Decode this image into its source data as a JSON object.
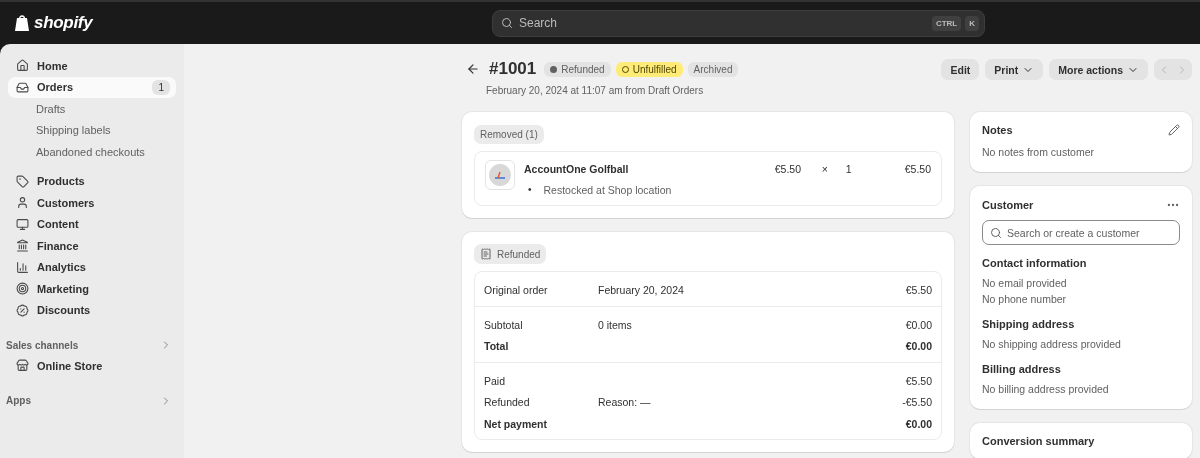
{
  "topbar": {
    "logo": "shopify",
    "search": {
      "placeholder": "Search",
      "keys": [
        "CTRL",
        "K"
      ]
    }
  },
  "sidebar": {
    "items": [
      {
        "label": "Home",
        "kind": "main",
        "selected": false
      },
      {
        "label": "Orders",
        "kind": "main",
        "selected": true,
        "count": "1"
      },
      {
        "label": "Drafts",
        "kind": "sub",
        "selected": false
      },
      {
        "label": "Shipping labels",
        "kind": "sub",
        "selected": false
      },
      {
        "label": "Abandoned checkouts",
        "kind": "sub",
        "selected": false
      },
      {
        "label": "Products",
        "kind": "main",
        "selected": false
      },
      {
        "label": "Customers",
        "kind": "main",
        "selected": false
      },
      {
        "label": "Content",
        "kind": "main",
        "selected": false
      },
      {
        "label": "Finance",
        "kind": "main",
        "selected": false
      },
      {
        "label": "Analytics",
        "kind": "main",
        "selected": false
      },
      {
        "label": "Marketing",
        "kind": "main",
        "selected": false
      },
      {
        "label": "Discounts",
        "kind": "main",
        "selected": false
      }
    ],
    "sections": [
      {
        "title": "Sales channels",
        "items": [
          {
            "label": "Online Store",
            "selected": false
          }
        ]
      },
      {
        "title": "Apps"
      }
    ]
  },
  "order": {
    "title": "#1001",
    "subtitle": "February 20, 2024 at 11:07 am from Draft Orders",
    "badges": [
      {
        "label": "Refunded",
        "kind": "dot"
      },
      {
        "label": "Unfulfilled",
        "kind": "ring"
      },
      {
        "label": "Archived",
        "kind": "plain"
      }
    ],
    "actions": [
      {
        "label": "Edit",
        "kind": "plain"
      },
      {
        "label": "Print",
        "kind": "menu"
      },
      {
        "label": "More actions",
        "kind": "menu"
      }
    ]
  },
  "removed": {
    "badge": "Removed (1)",
    "item": {
      "name": "AccountOne Golfball",
      "bullet": "•",
      "note": "Restocked at Shop location",
      "price": "€5.50",
      "times": "×",
      "quantity": "1",
      "total": "€5.50"
    }
  },
  "refund": {
    "badge": "Refunded",
    "groups": [
      [
        {
          "label": "Original order",
          "detail": "February 20, 2024",
          "amount": "€5.50",
          "emphasis": false
        }
      ],
      [
        {
          "label": "Subtotal",
          "detail": "0 items",
          "amount": "€0.00",
          "emphasis": false
        },
        {
          "label": "Total",
          "amount": "€0.00",
          "emphasis": true
        }
      ],
      [
        {
          "label": "Paid",
          "amount": "€5.50",
          "emphasis": false
        },
        {
          "label": "Refunded",
          "detail": "Reason: —",
          "amount": "-€5.50",
          "emphasis": false
        },
        {
          "label": "Net payment",
          "amount": "€0.00",
          "emphasis": true
        }
      ]
    ]
  },
  "notes": {
    "title": "Notes",
    "text": "No notes from customer"
  },
  "customer": {
    "title": "Customer",
    "search_placeholder": "Search or create a customer",
    "sections": [
      {
        "title": "Contact information",
        "lines": [
          "No email provided",
          "No phone number"
        ]
      },
      {
        "title": "Shipping address",
        "lines": [
          "No shipping address provided"
        ]
      },
      {
        "title": "Billing address",
        "lines": [
          "No billing address provided"
        ]
      }
    ]
  },
  "conversion": {
    "title": "Conversion summary"
  }
}
